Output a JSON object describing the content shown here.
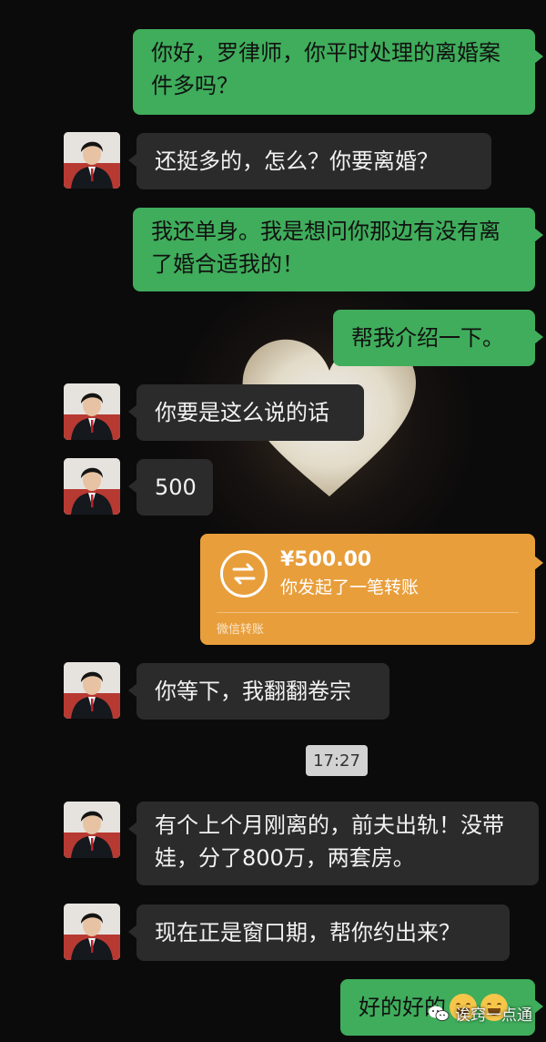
{
  "messages": [
    {
      "side": "right",
      "text": "你好，罗律师，你平时处理的离婚案件多吗？"
    },
    {
      "side": "left",
      "text": "还挺多的，怎么？你要离婚？"
    },
    {
      "side": "right",
      "text": "我还单身。我是想问你那边有没有离了婚合适我的！"
    },
    {
      "side": "right",
      "text": "帮我介绍一下。"
    },
    {
      "side": "left",
      "text": "你要是这么说的话"
    },
    {
      "side": "left",
      "text": "500"
    },
    {
      "side": "left",
      "text": "你等下，我翻翻卷宗"
    },
    {
      "side": "left",
      "text": "有个上个月刚离的，前夫出轨！没带娃，分了800万，两套房。"
    },
    {
      "side": "left",
      "text": "现在正是窗口期，帮你约出来？"
    },
    {
      "side": "right",
      "text": "好的好的"
    }
  ],
  "transfer": {
    "amount": "¥500.00",
    "description": "你发起了一笔转账",
    "footer": "微信转账",
    "color": "#e89e3b"
  },
  "timestamp": "17:27",
  "watermark": "诶窍一点通",
  "colors": {
    "outgoing_bubble": "#3fad5b",
    "incoming_bubble": "#2b2b2b",
    "background": "#0c0b0b"
  },
  "icons": {
    "transfer": "transfer-arrows-icon",
    "emoji": "grinning-emoji-icon",
    "watermark": "wechat-logo-icon"
  }
}
